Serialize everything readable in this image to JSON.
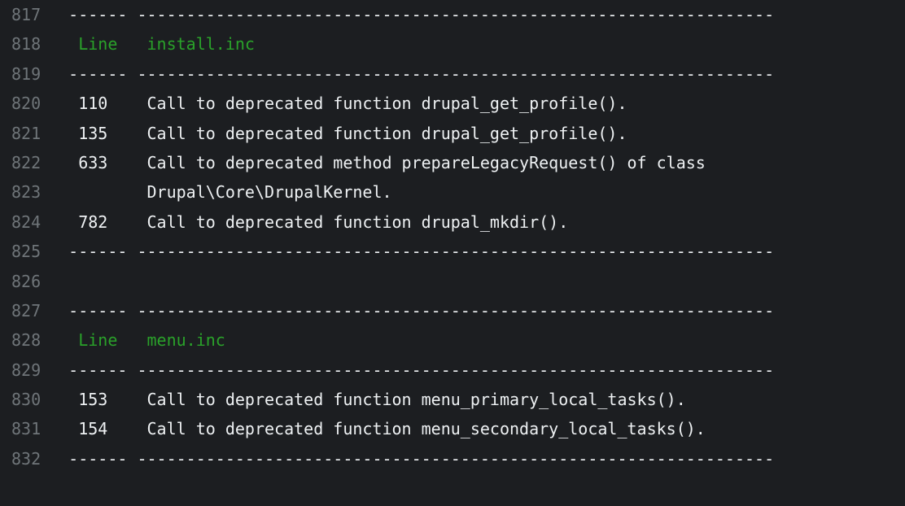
{
  "lines": [
    {
      "num": "817",
      "segments": [
        {
          "text": " ------ -----------------------------------------------------------------"
        }
      ]
    },
    {
      "num": "818",
      "segments": [
        {
          "text": "  ",
          "cls": ""
        },
        {
          "text": "Line",
          "cls": "green"
        },
        {
          "text": "   ",
          "cls": ""
        },
        {
          "text": "install.inc",
          "cls": "green"
        }
      ]
    },
    {
      "num": "819",
      "segments": [
        {
          "text": " ------ -----------------------------------------------------------------"
        }
      ]
    },
    {
      "num": "820",
      "segments": [
        {
          "text": "  110    Call to deprecated function drupal_get_profile()."
        }
      ]
    },
    {
      "num": "821",
      "segments": [
        {
          "text": "  135    Call to deprecated function drupal_get_profile()."
        }
      ]
    },
    {
      "num": "822",
      "segments": [
        {
          "text": "  633    Call to deprecated method prepareLegacyRequest() of class"
        }
      ]
    },
    {
      "num": "823",
      "segments": [
        {
          "text": "         Drupal\\Core\\DrupalKernel."
        }
      ]
    },
    {
      "num": "824",
      "segments": [
        {
          "text": "  782    Call to deprecated function drupal_mkdir()."
        }
      ]
    },
    {
      "num": "825",
      "segments": [
        {
          "text": " ------ -----------------------------------------------------------------"
        }
      ]
    },
    {
      "num": "826",
      "segments": [
        {
          "text": ""
        }
      ]
    },
    {
      "num": "827",
      "segments": [
        {
          "text": " ------ -----------------------------------------------------------------"
        }
      ]
    },
    {
      "num": "828",
      "segments": [
        {
          "text": "  ",
          "cls": ""
        },
        {
          "text": "Line",
          "cls": "green"
        },
        {
          "text": "   ",
          "cls": ""
        },
        {
          "text": "menu.inc",
          "cls": "green"
        }
      ]
    },
    {
      "num": "829",
      "segments": [
        {
          "text": " ------ -----------------------------------------------------------------"
        }
      ]
    },
    {
      "num": "830",
      "segments": [
        {
          "text": "  153    Call to deprecated function menu_primary_local_tasks()."
        }
      ]
    },
    {
      "num": "831",
      "segments": [
        {
          "text": "  154    Call to deprecated function menu_secondary_local_tasks()."
        }
      ]
    },
    {
      "num": "832",
      "segments": [
        {
          "text": " ------ -----------------------------------------------------------------"
        }
      ]
    }
  ]
}
